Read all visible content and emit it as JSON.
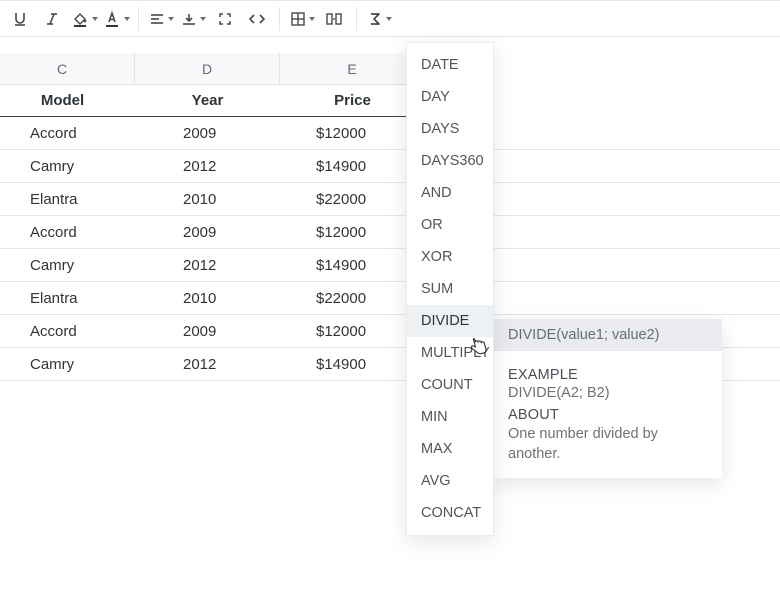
{
  "columns": {
    "c": "C",
    "d": "D",
    "e": "E"
  },
  "headers": {
    "model": "Model",
    "year": "Year",
    "price": "Price"
  },
  "rows": [
    {
      "model": "Accord",
      "year": "2009",
      "price": "$12000"
    },
    {
      "model": "Camry",
      "year": "2012",
      "price": "$14900"
    },
    {
      "model": "Elantra",
      "year": "2010",
      "price": "$22000"
    },
    {
      "model": "Accord",
      "year": "2009",
      "price": "$12000"
    },
    {
      "model": "Camry",
      "year": "2012",
      "price": "$14900"
    },
    {
      "model": "Elantra",
      "year": "2010",
      "price": "$22000"
    },
    {
      "model": "Accord",
      "year": "2009",
      "price": "$12000"
    },
    {
      "model": "Camry",
      "year": "2012",
      "price": "$14900"
    }
  ],
  "functions": {
    "items": [
      "DATE",
      "DAY",
      "DAYS",
      "DAYS360",
      "AND",
      "OR",
      "XOR",
      "SUM",
      "DIVIDE",
      "MULTIPLY",
      "COUNT",
      "MIN",
      "MAX",
      "AVG",
      "CONCAT"
    ],
    "hovered_index": 8
  },
  "tooltip": {
    "signature": "DIVIDE(value1; value2)",
    "example_h": "EXAMPLE",
    "example": "DIVIDE(A2; B2)",
    "about_h": "ABOUT",
    "about": "One number divided by another."
  },
  "icons": {
    "underline": "underline-icon",
    "italic": "italic-icon",
    "fillcolor": "fill-color-icon",
    "textcolor": "text-color-icon",
    "halign": "horizontal-align-icon",
    "valign": "vertical-align-icon",
    "expand": "expand-icon",
    "code": "code-icon",
    "table": "table-icon",
    "split": "split-cell-icon",
    "sigma": "sigma-icon"
  }
}
